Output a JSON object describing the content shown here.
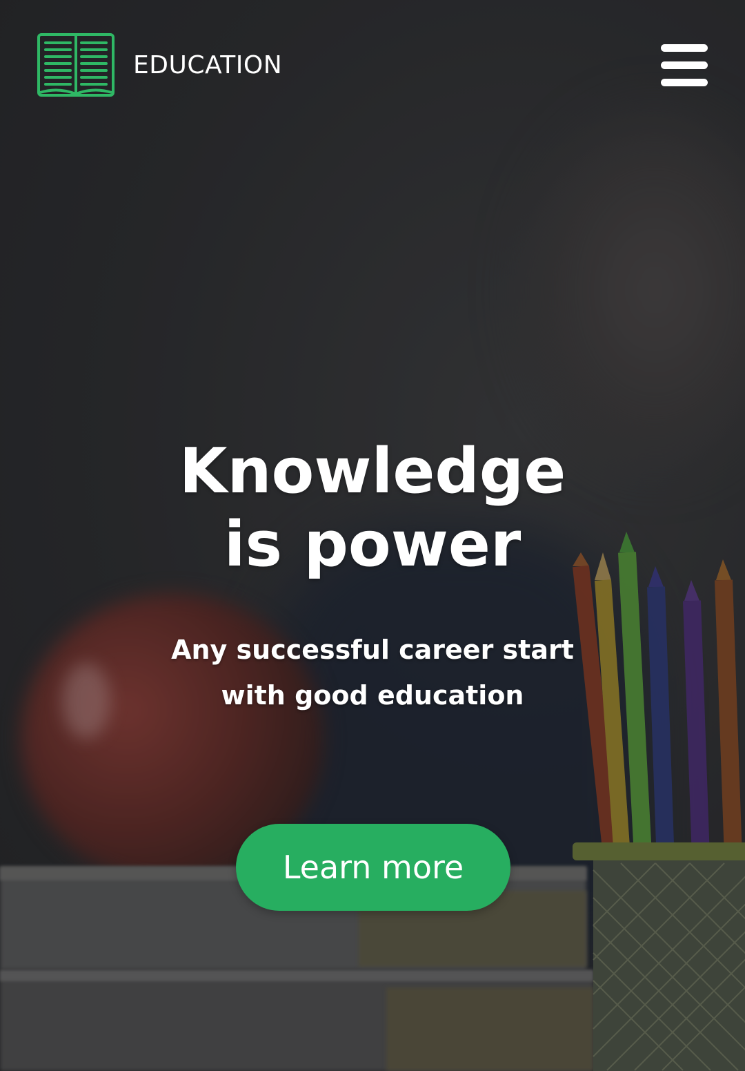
{
  "header": {
    "logo_icon": "open-book-icon",
    "brand": "EDUCATION",
    "menu_icon": "hamburger-menu-icon"
  },
  "hero": {
    "headline_line1": "Knowledge",
    "headline_line2": "is power",
    "subtitle_line1": "Any successful career start",
    "subtitle_line2": "with good education",
    "cta_label": "Learn more"
  },
  "colors": {
    "accent": "#27ae60",
    "logo_green": "#2fb865",
    "text": "#ffffff",
    "background": "#2c2e30"
  }
}
